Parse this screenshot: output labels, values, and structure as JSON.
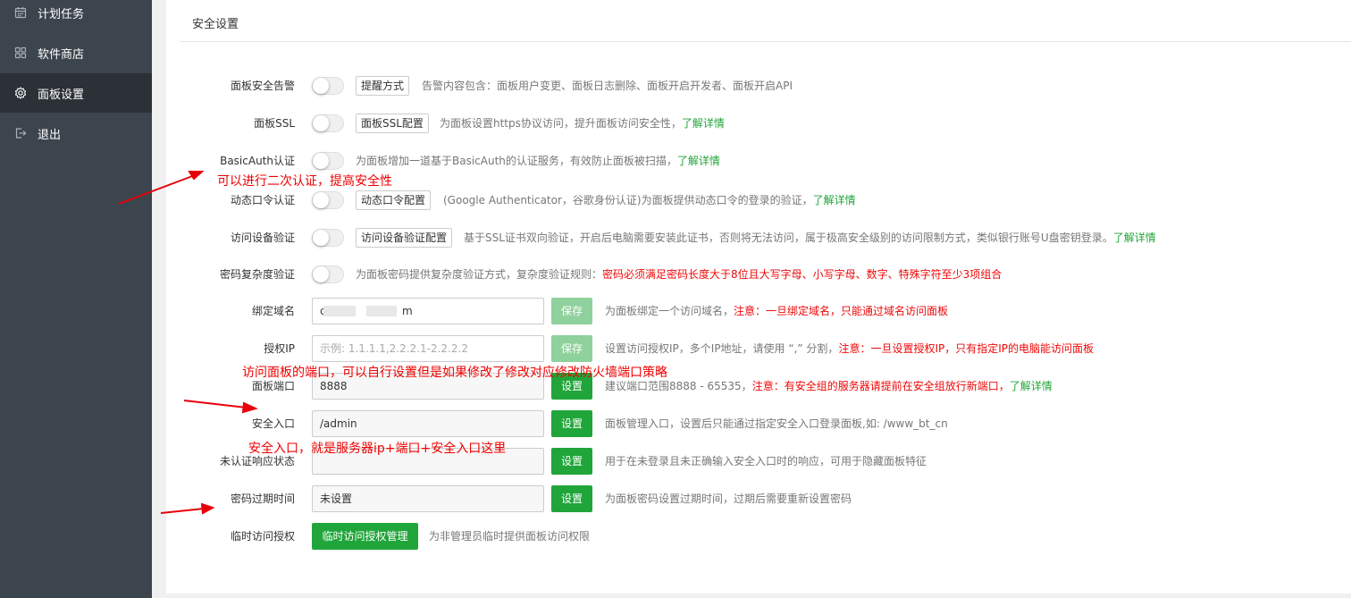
{
  "sidebar": {
    "items": [
      {
        "label": "计划任务",
        "icon": "calendar-icon"
      },
      {
        "label": "软件商店",
        "icon": "grid-icon"
      },
      {
        "label": "面板设置",
        "icon": "gear-icon",
        "active": true
      },
      {
        "label": "退出",
        "icon": "logout-icon"
      }
    ]
  },
  "panel": {
    "title": "安全设置"
  },
  "settings": {
    "alarm": {
      "label": "面板安全告警",
      "enabled": false,
      "button": "提醒方式",
      "desc": "告警内容包含：面板用户变更、面板日志删除、面板开启开发者、面板开启API"
    },
    "ssl": {
      "label": "面板SSL",
      "enabled": false,
      "button": "面板SSL配置",
      "desc": "为面板设置https协议访问，提升面板访问安全性，",
      "link": "了解详情"
    },
    "basic_auth": {
      "label": "BasicAuth认证",
      "enabled": false,
      "desc": "为面板增加一道基于BasicAuth的认证服务，有效防止面板被扫描，",
      "link": "了解详情"
    },
    "totp": {
      "label": "动态口令认证",
      "enabled": false,
      "button": "动态口令配置",
      "desc": "(Google Authenticator，谷歌身份认证)为面板提供动态口令的登录的验证，",
      "link": "了解详情"
    },
    "device": {
      "label": "访问设备验证",
      "enabled": false,
      "button": "访问设备验证配置",
      "desc": "基于SSL证书双向验证，开启后电脑需要安装此证书，否则将无法访问，属于极高安全级别的访问限制方式，类似银行账号U盘密钥登录。",
      "link": "了解详情"
    },
    "pwd_complex": {
      "label": "密码复杂度验证",
      "enabled": false,
      "desc": "为面板密码提供复杂度验证方式，复杂度验证规则：",
      "warn": "密码必须满足密码长度大于8位且大写字母、小写字母、数字、特殊字符至少3项组合"
    },
    "domain": {
      "label": "绑定域名",
      "value_start": "c",
      "value_end": "m",
      "button": "保存",
      "desc": "为面板绑定一个访问域名，",
      "warn": "注意：一旦绑定域名，只能通过域名访问面板"
    },
    "auth_ip": {
      "label": "授权IP",
      "placeholder": "示例: 1.1.1.1,2.2.2.1-2.2.2.2",
      "button": "保存",
      "desc": "设置访问授权IP，多个IP地址，请使用 “,” 分割，",
      "warn": "注意：一旦设置授权IP，只有指定IP的电脑能访问面板"
    },
    "port": {
      "label": "面板端口",
      "value": "8888",
      "button": "设置",
      "desc": "建议端口范围8888 - 65535，",
      "warn": "注意：有安全组的服务器请提前在安全组放行新端口，",
      "link": "了解详情"
    },
    "entrance": {
      "label": "安全入口",
      "value": "/admin",
      "button": "设置",
      "desc": "面板管理入口，设置后只能通过指定安全入口登录面板,如: /www_bt_cn"
    },
    "unauth": {
      "label": "未认证响应状态",
      "value": "",
      "button": "设置",
      "desc": "用于在未登录且未正确输入安全入口时的响应，可用于隐藏面板特征"
    },
    "pwd_expire": {
      "label": "密码过期时间",
      "value": "未设置",
      "button": "设置",
      "desc": "为面板密码设置过期时间，过期后需要重新设置密码"
    },
    "temp_access": {
      "label": "临时访问授权",
      "button": "临时访问授权管理",
      "desc": "为非管理员临时提供面板访问权限"
    }
  },
  "annotations": {
    "basic_auth_note": "可以进行二次认证，提高安全性",
    "port_note": "访问面板的端口，可以自行设置但是如果修改了修改对应修改防火墙端口策略",
    "entrance_note": "安全入口，就是服务器ip+端口+安全入口这里"
  },
  "colors": {
    "sidebar_bg": "#3c444d",
    "sidebar_active": "#2c3138",
    "accent_green": "#20a53a",
    "warning_red": "#ef0808",
    "annotation_red": "#ef0000"
  }
}
